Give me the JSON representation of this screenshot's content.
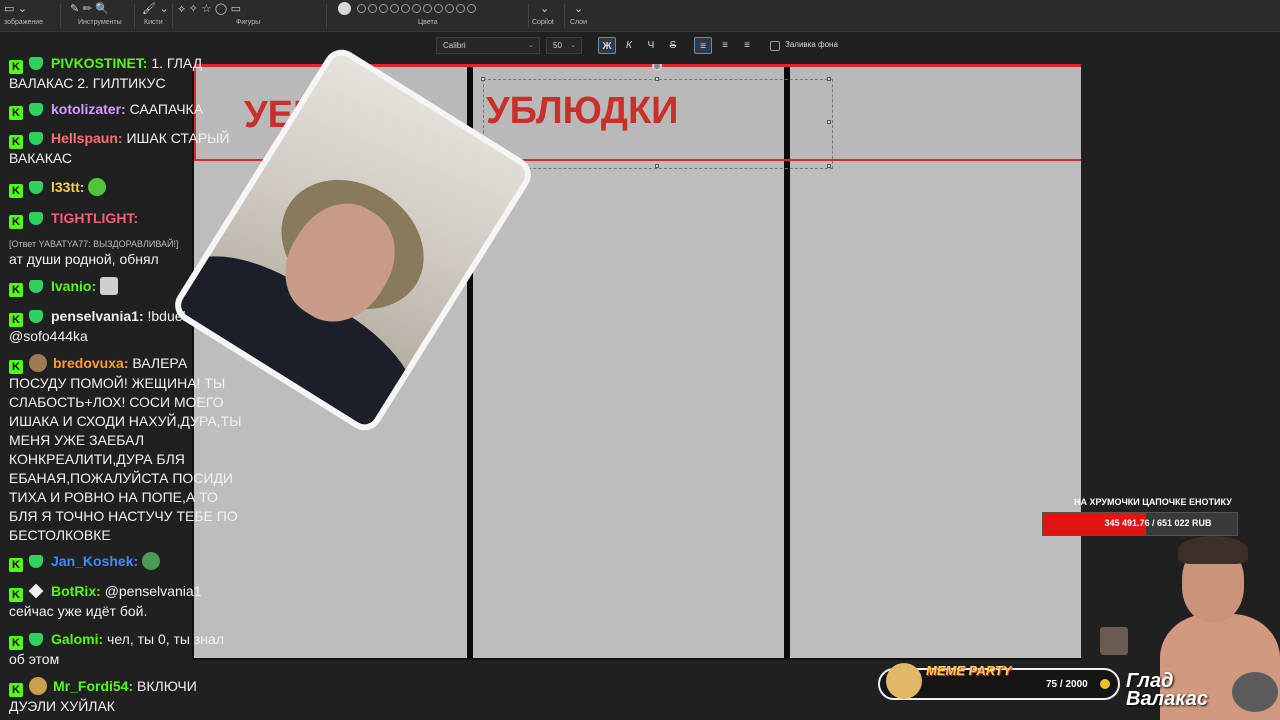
{
  "ribbon": {
    "groups": [
      {
        "label": "зображение",
        "icons": "▭ ⌄"
      },
      {
        "label": "Инструменты",
        "icons": "✎ ✏ 🔍"
      },
      {
        "label": "Кисти",
        "icons": "🖌 ⌄"
      },
      {
        "label": "Фигуры",
        "icons": "⟡ ✧ ☆ ◯ ▭"
      },
      {
        "label": "Цвета",
        "icons": ""
      },
      {
        "label": "Copilot",
        "icons": "⌄"
      },
      {
        "label": "Слои",
        "icons": "⌄"
      }
    ]
  },
  "text_toolbar": {
    "font": "Calibri",
    "size": "50",
    "bold": "Ж",
    "italic": "К",
    "underline": "Ч",
    "strike": "S",
    "fill_label": "Заливка фона"
  },
  "canvas": {
    "red_text_left": "УЕР",
    "red_text_right": "УБЛЮДКИ"
  },
  "chat": {
    "messages": [
      {
        "user": "PIVKOSTINET",
        "color": "#53fc18",
        "badge": "heart",
        "first": "1. ГЛАД",
        "rest": "ВАЛАКАС 2. ГИЛТИКУС"
      },
      {
        "user": "kotolizater",
        "color": "#d59cff",
        "badge": "heart",
        "first": "СААПАЧКА",
        "rest": ""
      },
      {
        "user": "Hellspaun",
        "color": "#ff6f6f",
        "badge": "heart",
        "first": "ИШАК СТАРЫЙ",
        "rest": "ВАКАКАС"
      },
      {
        "user": "l33tt",
        "color": "#f5d04a",
        "badge": "heart",
        "first": "",
        "rest": ""
      },
      {
        "user": "TIGHTLIGHT",
        "color": "#ff5a7a",
        "badge": "heart",
        "first": "",
        "rest": "ат души родной, обнял",
        "reply": "[Ответ YABATYA77: ВЫЗДОРАВЛИВАЙ!]"
      },
      {
        "user": "Ivanio",
        "color": "#53fc18",
        "badge": "heart",
        "first": "",
        "rest": ""
      },
      {
        "user": "penselvania1",
        "color": "#f0f0f0",
        "badge": "heart",
        "first": "!bduel",
        "rest": "@sofo444ka"
      },
      {
        "user": "bredovuxa",
        "color": "#ff9d2e",
        "badge": "avatar",
        "first": "ВАЛЕРА",
        "rest": "ПОСУДУ ПОМОЙ! ЖЕЩИНА! ТЫ\nСЛАБОСТЬ+ЛОХ! СОСИ МОЕГО\nИШАКА И СХОДИ НАХУЙ,ДУРА,ТЫ\nМЕНЯ УЖЕ ЗАЕБАЛ\nКОНКРЕАЛИТИ,ДУРА БЛЯ\nЕБАНАЯ,ПОЖАЛУЙСТА ПОСИДИ\nТИХА И РОВНО НА ПОПЕ,А ТО\nБЛЯ Я ТОЧНО НАСТУЧУ ТЕБЕ ПО\nБЕСТОЛКОВКЕ"
      },
      {
        "user": "Jan_Koshek",
        "color": "#3d8bff",
        "badge": "heart",
        "first": "",
        "rest": ""
      },
      {
        "user": "BotRix",
        "color": "#53fc18",
        "badge": "diamond",
        "first": "@penselvania1",
        "rest": "сейчас уже идёт бой."
      },
      {
        "user": "Galomi",
        "color": "#53fc18",
        "badge": "heart",
        "first": "чел, ты 0, ты знал",
        "rest": "об этом"
      },
      {
        "user": "Mr_Fordi54",
        "color": "#53fc18",
        "badge": "avatar2",
        "first": "ВКЛЮЧИ",
        "rest": "ДУЭЛИ ХУЙЛАК"
      }
    ],
    "k": "K",
    "colon": ":"
  },
  "donation": {
    "title": "НА ХРУМОЧКИ ЦАПОЧКЕ ЕНОТИКУ",
    "progress_text": "345 491.76 / 651 022 RUB",
    "progress": 0.53
  },
  "meme": {
    "title": "MEME PARTY",
    "count": "75 / 2000"
  },
  "streamer": {
    "name_line1": "Глад",
    "name_line2": "Валакас"
  }
}
